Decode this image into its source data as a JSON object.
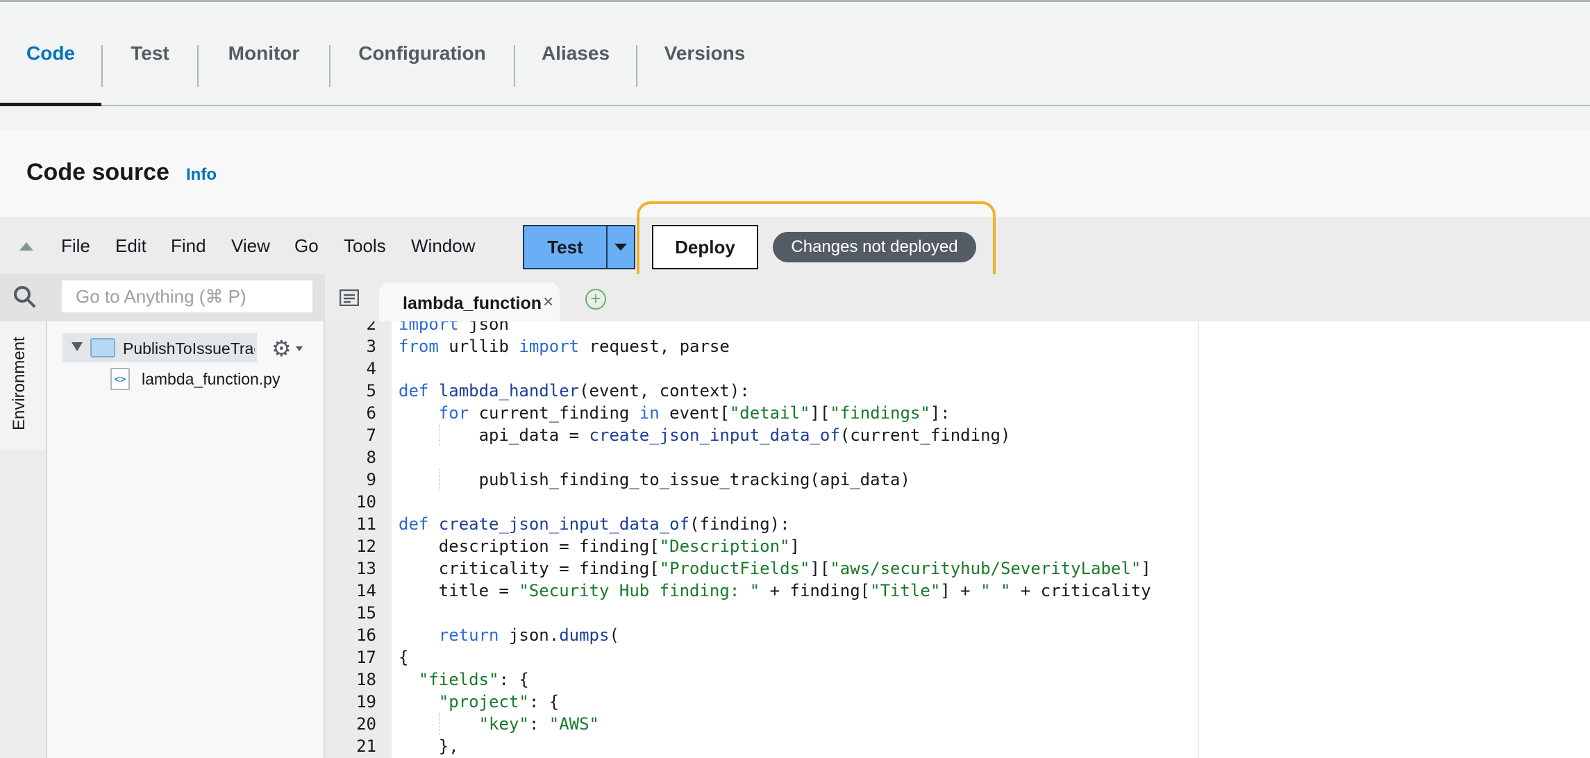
{
  "tabs": [
    {
      "label": "Code",
      "active": true
    },
    {
      "label": "Test",
      "active": false
    },
    {
      "label": "Monitor",
      "active": false
    },
    {
      "label": "Configuration",
      "active": false
    },
    {
      "label": "Aliases",
      "active": false
    },
    {
      "label": "Versions",
      "active": false
    }
  ],
  "code_source": {
    "title": "Code source",
    "info_link": "Info"
  },
  "menu": {
    "items": [
      "File",
      "Edit",
      "Find",
      "View",
      "Go",
      "Tools",
      "Window"
    ],
    "test_button": "Test",
    "deploy_button": "Deploy",
    "status_badge": "Changes not deployed"
  },
  "search": {
    "placeholder": "Go to Anything (⌘ P)"
  },
  "editor_tab": {
    "label": "lambda_function",
    "close_glyph": "×",
    "add_glyph": "+"
  },
  "environment": {
    "label": "Environment",
    "folder": "PublishToIssueTrack",
    "file": "lambda_function.py"
  },
  "code_lines": [
    {
      "num": "2",
      "text": "import json"
    },
    {
      "num": "3",
      "text": "from urllib import request, parse"
    },
    {
      "num": "4",
      "text": ""
    },
    {
      "num": "5",
      "text": "def lambda_handler(event, context):"
    },
    {
      "num": "6",
      "text": "    for current_finding in event[\"detail\"][\"findings\"]:"
    },
    {
      "num": "7",
      "text": "        api_data = create_json_input_data_of(current_finding)"
    },
    {
      "num": "8",
      "text": ""
    },
    {
      "num": "9",
      "text": "        publish_finding_to_issue_tracking(api_data)"
    },
    {
      "num": "10",
      "text": ""
    },
    {
      "num": "11",
      "text": "def create_json_input_data_of(finding):"
    },
    {
      "num": "12",
      "text": "    description = finding[\"Description\"]"
    },
    {
      "num": "13",
      "text": "    criticality = finding[\"ProductFields\"][\"aws/securityhub/SeverityLabel\"]"
    },
    {
      "num": "14",
      "text": "    title = \"Security Hub finding: \" + finding[\"Title\"] + \" \" + criticality"
    },
    {
      "num": "15",
      "text": ""
    },
    {
      "num": "16",
      "text": "    return json.dumps("
    },
    {
      "num": "17",
      "text": "{"
    },
    {
      "num": "18",
      "text": "  \"fields\": {"
    },
    {
      "num": "19",
      "text": "    \"project\": {"
    },
    {
      "num": "20",
      "text": "        \"key\": \"AWS\""
    },
    {
      "num": "21",
      "text": "    },"
    }
  ],
  "colors": {
    "accent": "#0073bb",
    "test_button": "#6aaef5",
    "highlight": "#f0b132",
    "badge": "#545b64"
  }
}
